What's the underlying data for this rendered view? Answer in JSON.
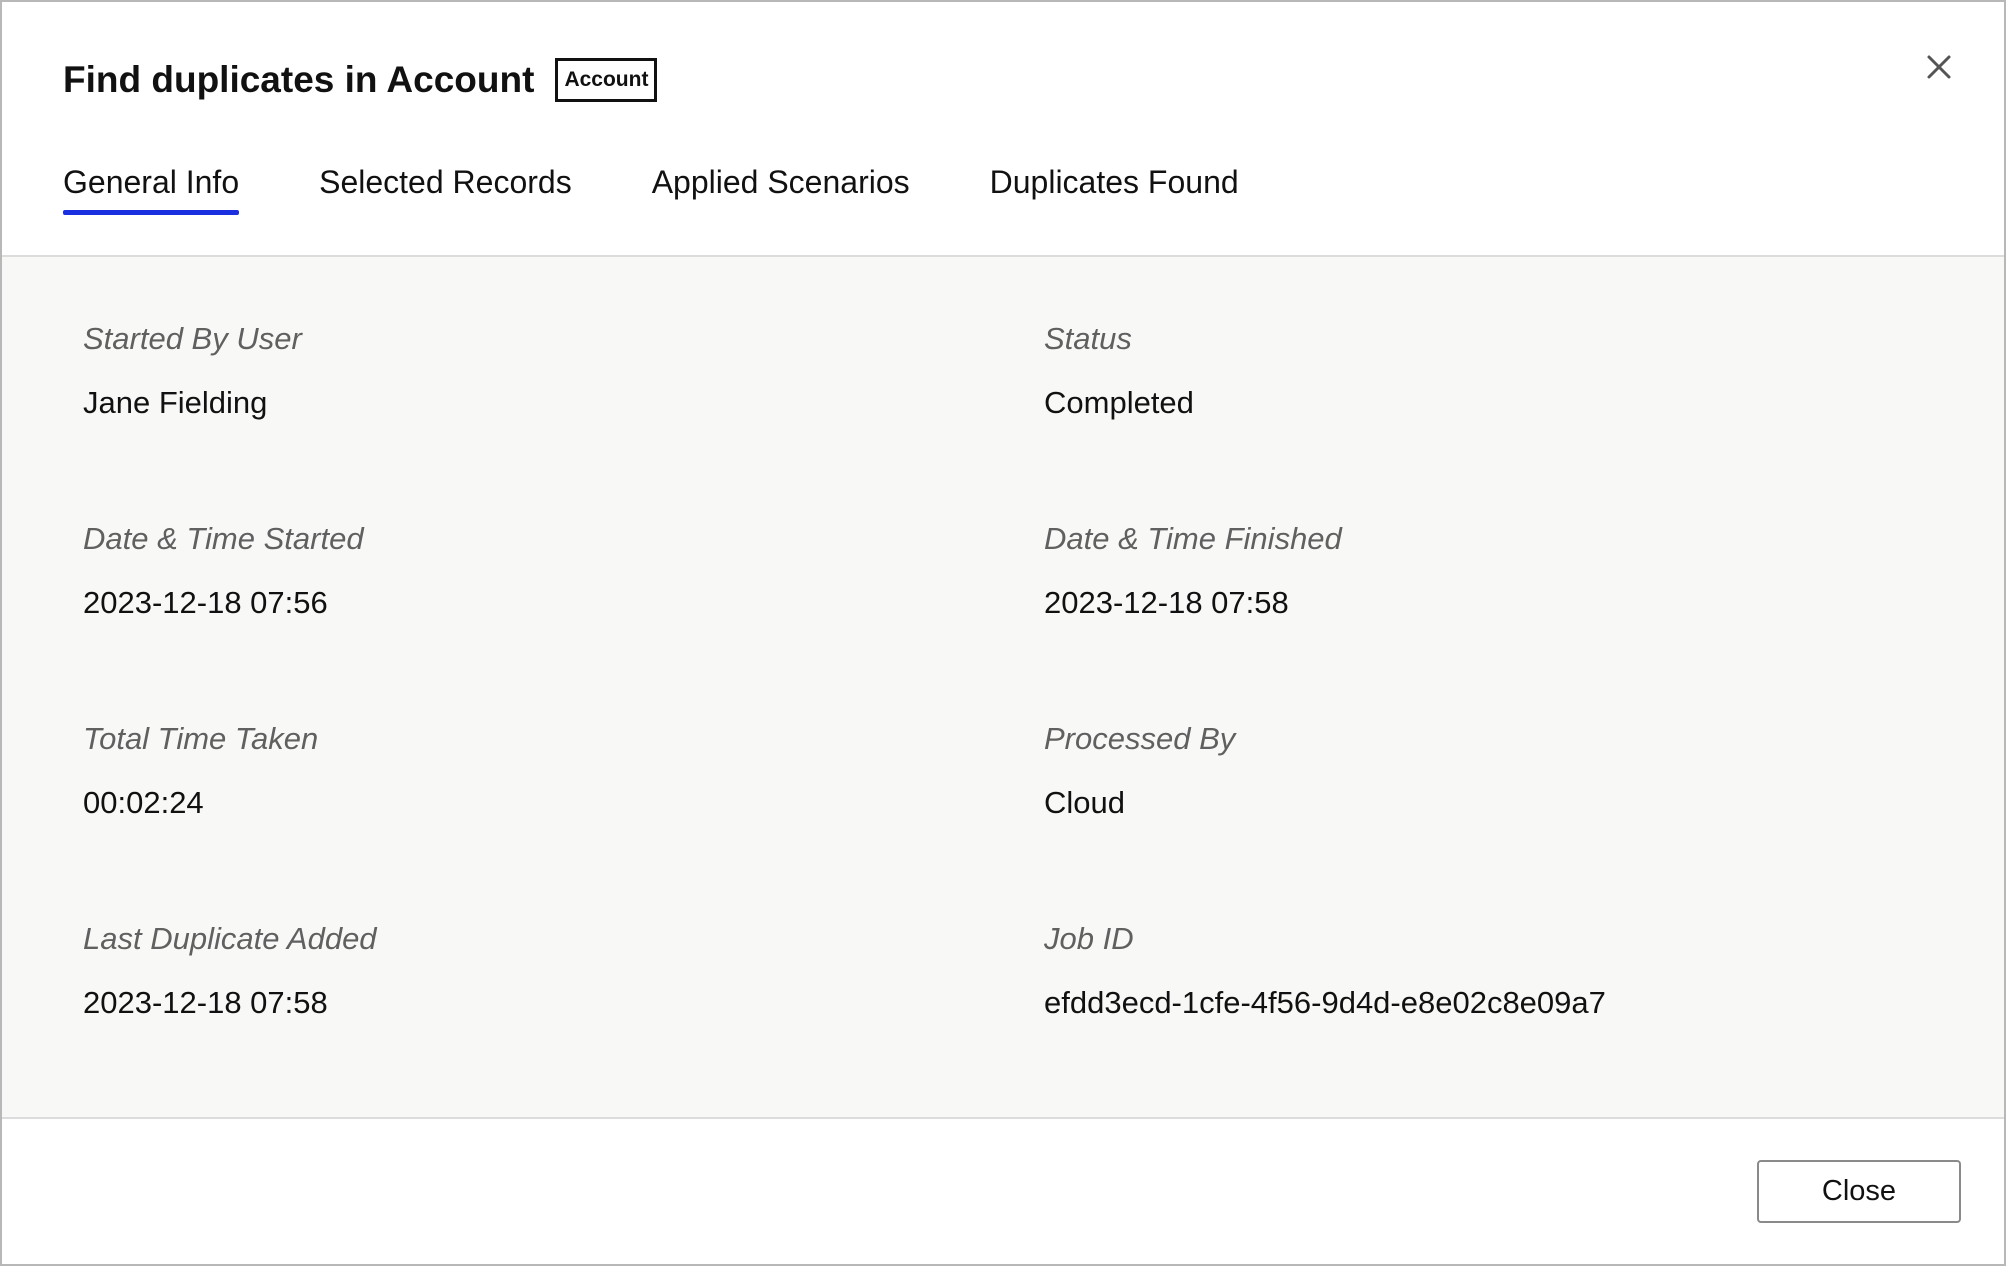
{
  "dialog": {
    "title": "Find duplicates in Account",
    "entity_badge": "Account",
    "close_icon": "close-icon"
  },
  "tabs": [
    {
      "label": "General Info",
      "active": true
    },
    {
      "label": "Selected Records",
      "active": false
    },
    {
      "label": "Applied Scenarios",
      "active": false
    },
    {
      "label": "Duplicates Found",
      "active": false
    }
  ],
  "fields": {
    "started_by": {
      "label": "Started By User",
      "value": "Jane Fielding"
    },
    "status": {
      "label": "Status",
      "value": "Completed"
    },
    "date_started": {
      "label": "Date & Time Started",
      "value": "2023-12-18 07:56"
    },
    "date_finished": {
      "label": "Date & Time Finished",
      "value": "2023-12-18 07:58"
    },
    "total_time": {
      "label": "Total Time Taken",
      "value": "00:02:24"
    },
    "processed_by": {
      "label": "Processed By",
      "value": "Cloud"
    },
    "last_duplicate": {
      "label": "Last Duplicate Added",
      "value": "2023-12-18 07:58"
    },
    "job_id": {
      "label": "Job ID",
      "value": "efdd3ecd-1cfe-4f56-9d4d-e8e02c8e09a7"
    }
  },
  "footer": {
    "close_label": "Close"
  },
  "colors": {
    "active_tab_underline": "#1a2fe0",
    "body_background": "#f8f8f7",
    "label_text": "#606060"
  }
}
